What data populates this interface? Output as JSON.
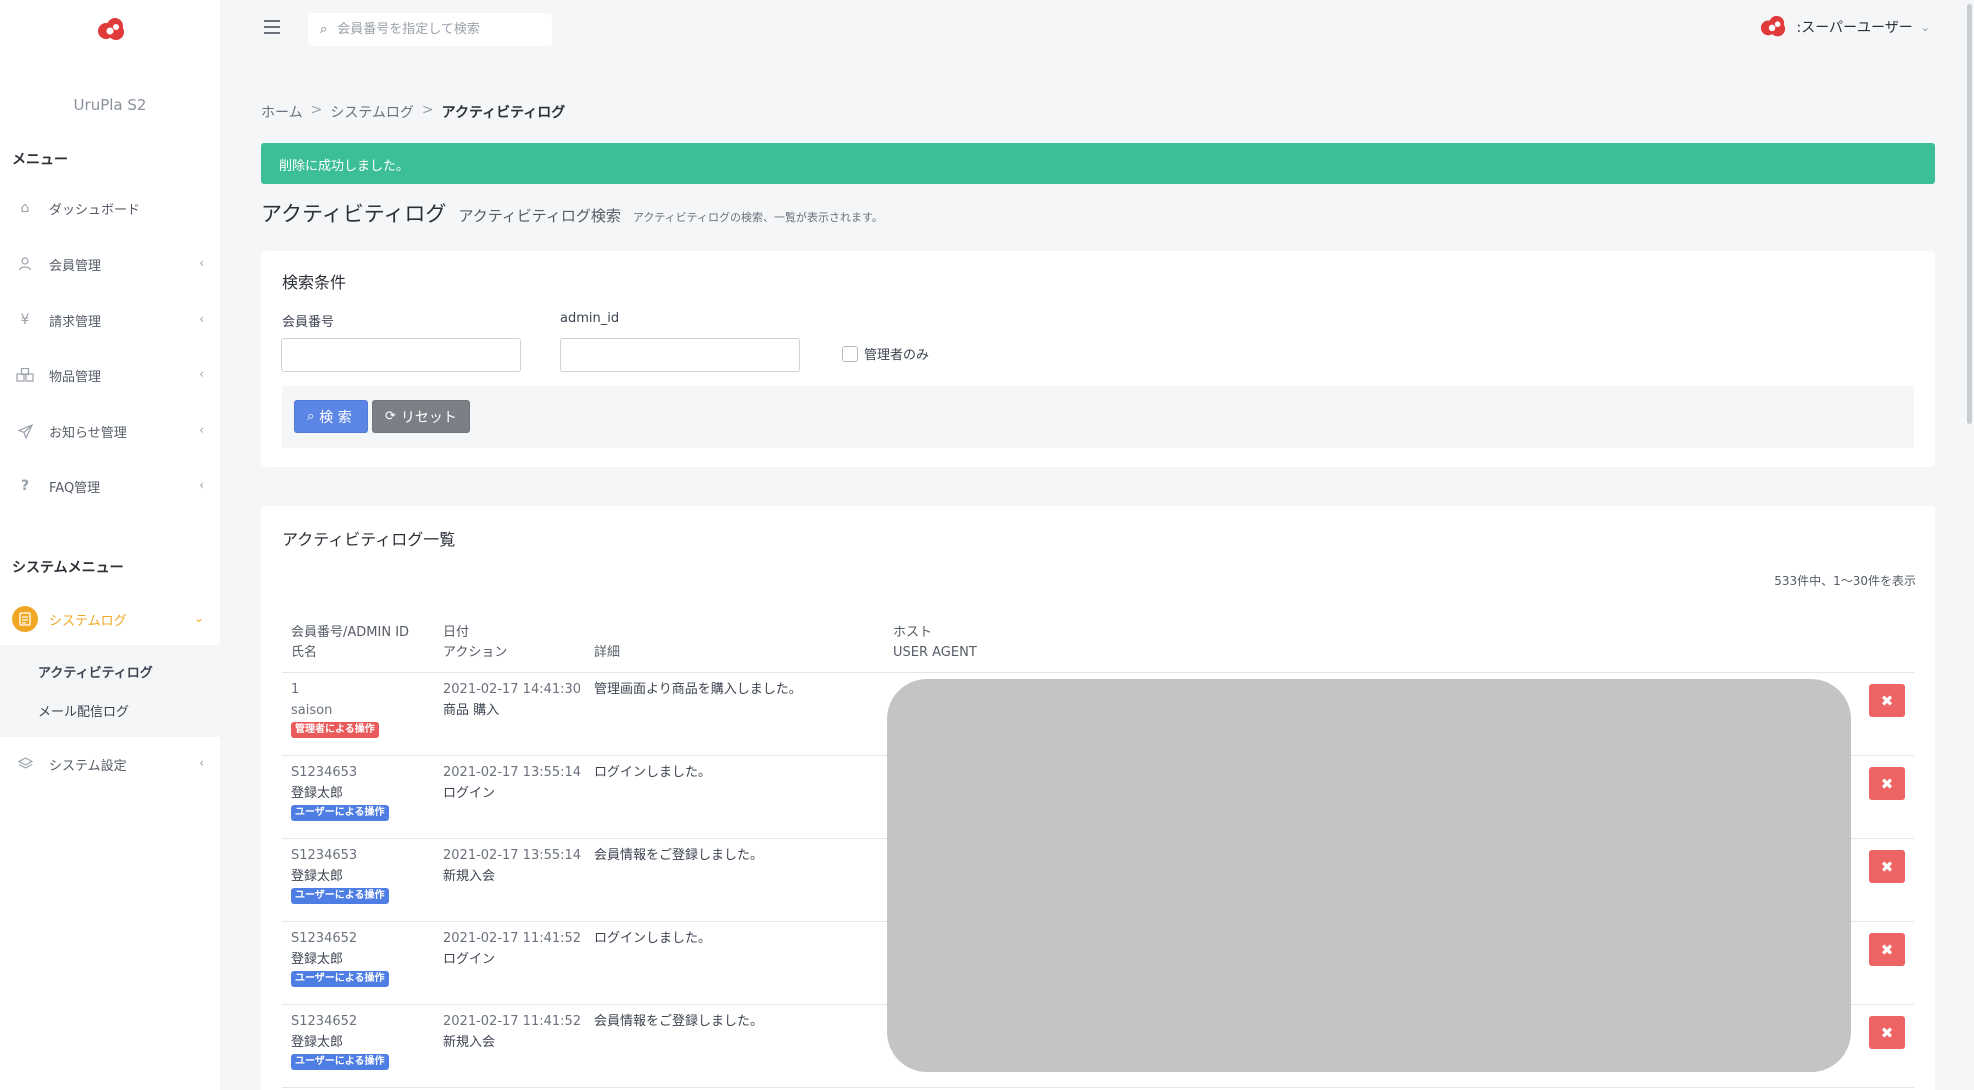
{
  "app": {
    "name": "UruPla S2"
  },
  "colors": {
    "accent": "#f0a824",
    "success": "#3cbf96",
    "danger": "#ee6464",
    "primary": "#5b86e5",
    "brand": "#e03a3a"
  },
  "sidebar": {
    "menu_heading": "メニュー",
    "items": [
      {
        "label": "ダッシュボード",
        "icon": "home-icon"
      },
      {
        "label": "会員管理",
        "icon": "user-icon"
      },
      {
        "label": "請求管理",
        "icon": "yen-icon"
      },
      {
        "label": "物品管理",
        "icon": "boxes-icon"
      },
      {
        "label": "お知らせ管理",
        "icon": "send-icon"
      },
      {
        "label": "FAQ管理",
        "icon": "question-icon"
      }
    ],
    "system_heading": "システムメニュー",
    "system_items": [
      {
        "label": "システムログ",
        "icon": "document-icon"
      },
      {
        "label": "システム設定",
        "icon": "layers-icon"
      }
    ],
    "sub_items": [
      {
        "label": "アクティビティログ"
      },
      {
        "label": "メール配信ログ"
      }
    ]
  },
  "topbar": {
    "search_placeholder": "会員番号を指定して検索",
    "user_label": ":スーパーユーザー"
  },
  "breadcrumb": [
    "ホーム",
    "システムログ",
    "アクティビティログ"
  ],
  "alert": {
    "message": "削除に成功しました。"
  },
  "page": {
    "title": "アクティビティログ",
    "subtitle": "アクティビティログ検索",
    "description": "アクティビティログの検索、一覧が表示されます。"
  },
  "search_form": {
    "title": "検索条件",
    "member_no_label": "会員番号",
    "member_no_value": "",
    "admin_id_label": "admin_id",
    "admin_id_value": "",
    "admin_only_label": "管理者のみ",
    "admin_only_checked": false,
    "search_button": "検 索",
    "reset_button": "リセット"
  },
  "list": {
    "title": "アクティビティログ一覧",
    "count_text": "533件中、1〜30件を表示",
    "headers": {
      "col1_line1": "会員番号/ADMIN ID",
      "col1_line2": "氏名",
      "col2_line1": "日付",
      "col2_line2": "アクション",
      "col3": "詳細",
      "col4_line1": "ホスト",
      "col4_line2": "USER AGENT"
    },
    "rows": [
      {
        "id": "1",
        "name": "saison",
        "badge": "管理者による操作",
        "badge_type": "admin",
        "date": "2021-02-17 14:41:30",
        "action": "商品 購入",
        "detail": "管理画面より商品を購入しました。"
      },
      {
        "id": "S1234653",
        "name": "登録太郎",
        "badge": "ユーザーによる操作",
        "badge_type": "user",
        "date": "2021-02-17 13:55:14",
        "action": "ログイン",
        "detail": "ログインしました。"
      },
      {
        "id": "S1234653",
        "name": "登録太郎",
        "badge": "ユーザーによる操作",
        "badge_type": "user",
        "date": "2021-02-17 13:55:14",
        "action": "新規入会",
        "detail": "会員情報をご登録しました。"
      },
      {
        "id": "S1234652",
        "name": "登録太郎",
        "badge": "ユーザーによる操作",
        "badge_type": "user",
        "date": "2021-02-17 11:41:52",
        "action": "ログイン",
        "detail": "ログインしました。"
      },
      {
        "id": "S1234652",
        "name": "登録太郎",
        "badge": "ユーザーによる操作",
        "badge_type": "user",
        "date": "2021-02-17 11:41:52",
        "action": "新規入会",
        "detail": "会員情報をご登録しました。"
      }
    ],
    "delete_icon": "close-icon"
  }
}
